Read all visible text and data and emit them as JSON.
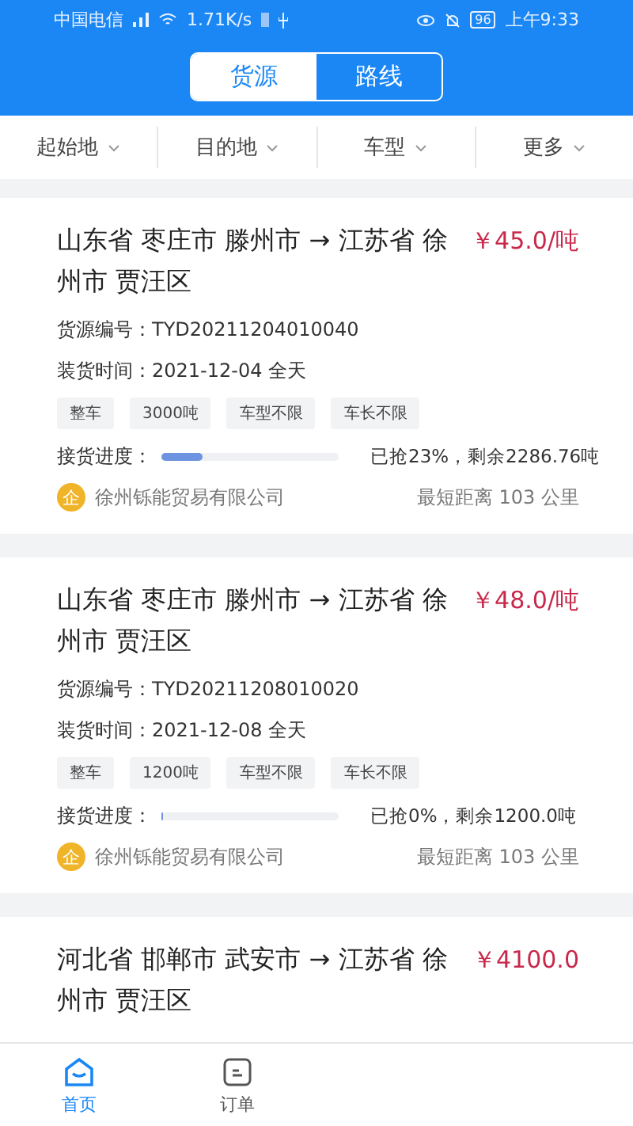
{
  "status_bar": {
    "carrier": "中国电信",
    "speed": "1.71K/s",
    "battery": "96",
    "time": "上午9:33"
  },
  "segments": [
    {
      "label": "货源",
      "selected": true
    },
    {
      "label": "路线",
      "selected": false
    }
  ],
  "filters": [
    "起始地",
    "目的地",
    "车型",
    "更多"
  ],
  "cargo": [
    {
      "route": "山东省 枣庄市 滕州市 → 江苏省 徐州市 贾汪区",
      "price": "￥45.0/吨",
      "number": "货源编号：TYD20211204010040",
      "time": "装货时间：2021-12-04 全天",
      "tags": [
        "整车",
        "3000吨",
        "车型不限",
        "车长不限"
      ],
      "progress_label": "接货进度：",
      "level": 0.23,
      "progress_text": "已抢23%，剩余2286.76吨",
      "badge": "企",
      "company": "徐州铄能贸易有限公司",
      "distance": "最短距离 103 公里"
    },
    {
      "route": "山东省 枣庄市 滕州市 → 江苏省 徐州市 贾汪区",
      "price": "￥48.0/吨",
      "number": "货源编号：TYD20211208010020",
      "time": "装货时间：2021-12-08 全天",
      "tags": [
        "整车",
        "1200吨",
        "车型不限",
        "车长不限"
      ],
      "progress_label": "接货进度：",
      "level": 0,
      "progress_text": "已抢0%，剩余1200.0吨",
      "badge": "企",
      "company": "徐州铄能贸易有限公司",
      "distance": "最短距离 103 公里"
    },
    {
      "route": "河北省 邯郸市 武安市 → 江苏省 徐州市 贾汪区",
      "price": "￥4100.0"
    }
  ],
  "nav": [
    {
      "kind": "home",
      "label": "首页",
      "selected": true
    },
    {
      "kind": "orders",
      "label": "订单",
      "selected": false
    }
  ]
}
